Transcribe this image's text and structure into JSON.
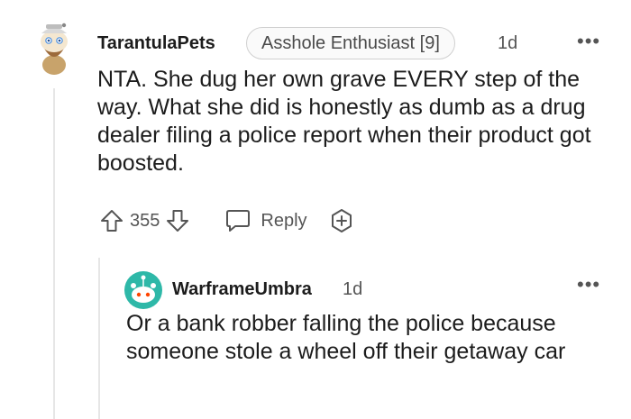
{
  "comment": {
    "username": "TarantulaPets",
    "flair": "Asshole Enthusiast [9]",
    "age": "1d",
    "more_label": "•••",
    "body": "NTA. She dug her own grave EVERY step of the way. What she did is honestly as dumb as a drug dealer filing a police report when their product got boosted.",
    "score": "355",
    "reply_label": "Reply"
  },
  "reply": {
    "username": "WarframeUmbra",
    "age": "1d",
    "more_label": "•••",
    "body": "Or a bank robber falling the police because someone stole a wheel off their getaway car"
  },
  "icons": {
    "avatar_main": "snoo-avatar-icon",
    "avatar_reply": "snoo-avatar-icon",
    "upvote": "upvote-arrow-icon",
    "downvote": "downvote-arrow-icon",
    "reply": "speech-bubble-icon",
    "award": "add-award-icon"
  },
  "colors": {
    "text": "#1c1c1c",
    "muted": "#555555",
    "reply_avatar_bg": "#2eb8a8",
    "thread_line": "#e6e6e6"
  }
}
